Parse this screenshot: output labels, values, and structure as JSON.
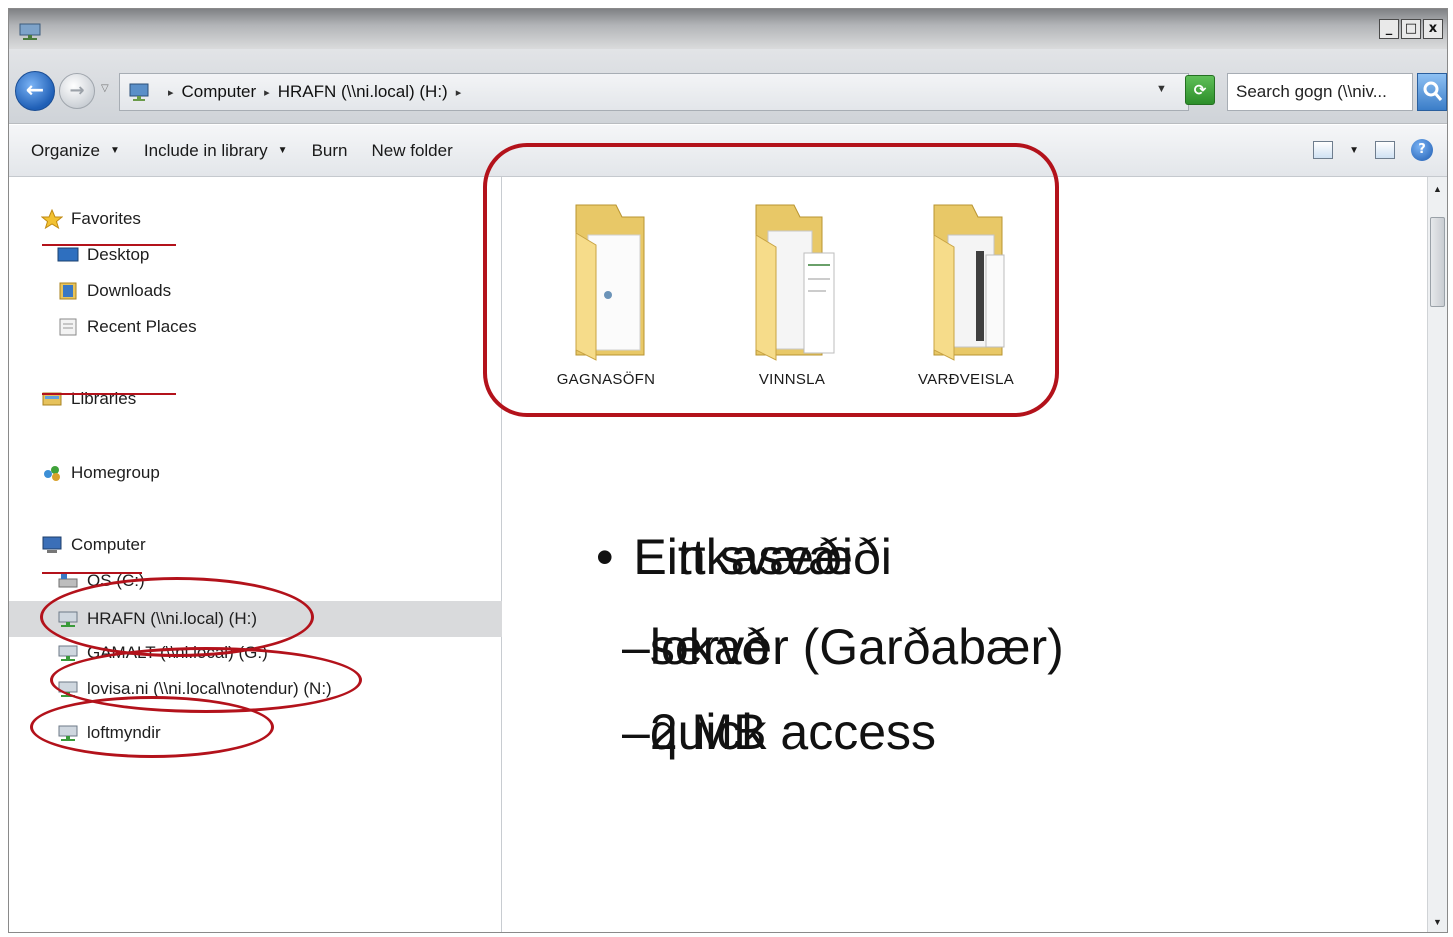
{
  "window": {
    "controls": {
      "minimize": "_",
      "maximize": "□",
      "close": "x"
    }
  },
  "nav": {
    "back_glyph": "←",
    "forward_glyph": "→"
  },
  "address": {
    "crumbs": [
      "Computer",
      "HRAFN (\\\\ni.local) (H:)"
    ],
    "search_placeholder": "Search gogn (\\\\niv..."
  },
  "toolbar": {
    "organize": "Organize",
    "include_in_library": "Include in library",
    "burn": "Burn",
    "new_folder": "New folder",
    "help": "?"
  },
  "sidebar": {
    "favorites": "Favorites",
    "desktop": "Desktop",
    "downloads": "Downloads",
    "recent_places": "Recent Places",
    "libraries": "Libraries",
    "homegroup": "Homegroup",
    "computer": "Computer",
    "os_drive": "OS (C:)",
    "hrafn": "HRAFN (\\\\ni.local) (H:)",
    "gamalt": "GAMALT (\\\\ni.local) (G:)",
    "lovisa": "lovisa.ni (\\\\ni.local\\notendur) (N:)",
    "loftmyndir": "loftmyndir"
  },
  "folders": [
    {
      "name": "GAGNASÖFN"
    },
    {
      "name": "VINNSLA"
    },
    {
      "name": "VARÐVEISLA"
    }
  ],
  "overlay": {
    "bullet": "•",
    "dash": "–",
    "line1_a": "Eitt svæði",
    "line1_b": "Einkasvæði",
    "line2_a": "lokað",
    "line2_b": "server (Garðabær)",
    "line3_a": "2 MB",
    "line3_b": "quick access"
  },
  "colors": {
    "annotation_red": "#b3121b",
    "folder_yellow": "#f6dc8a",
    "selected_row": "#d9dadc"
  }
}
